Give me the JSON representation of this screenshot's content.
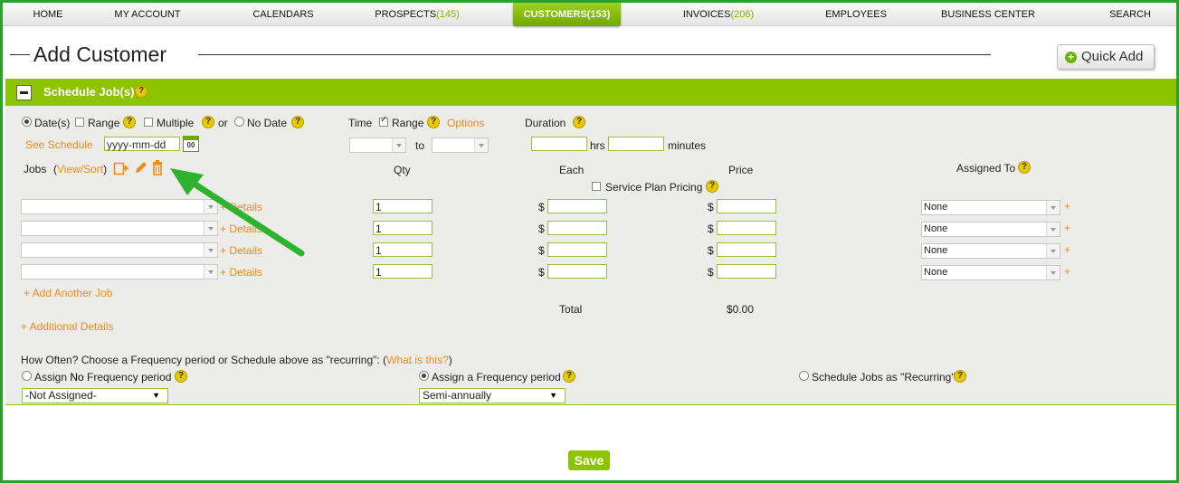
{
  "nav": {
    "items": [
      {
        "label": "HOME",
        "count": ""
      },
      {
        "label": "MY ACCOUNT",
        "count": ""
      },
      {
        "label": "CALENDARS",
        "count": ""
      },
      {
        "label": "PROSPECTS",
        "count": "(145)"
      },
      {
        "label": "INVOICES",
        "count": "(206)"
      },
      {
        "label": "EMPLOYEES",
        "count": ""
      },
      {
        "label": "BUSINESS CENTER",
        "count": ""
      },
      {
        "label": "SEARCH",
        "count": ""
      }
    ],
    "active": {
      "label": "CUSTOMERS",
      "count": "(153)"
    }
  },
  "header": {
    "title": "Add Customer",
    "quick_add": "Quick Add"
  },
  "section": {
    "title": "Schedule Job(s)"
  },
  "date": {
    "dates_label": "Date(s)",
    "range_label": "Range",
    "multiple_label": "Multiple",
    "or_label": "or",
    "no_date_label": "No Date",
    "see_schedule": "See Schedule",
    "date_placeholder": "yyyy-mm-dd",
    "cal_day": "00"
  },
  "time": {
    "label": "Time",
    "range_label": "Range",
    "options_link": "Options",
    "to_label": "to"
  },
  "duration": {
    "label": "Duration",
    "hrs_label": "hrs",
    "minutes_label": "minutes"
  },
  "jobs": {
    "label": "Jobs",
    "view_sort": "View/Sort",
    "open_paren": "(",
    "close_paren": ")",
    "cols": {
      "qty": "Qty",
      "each": "Each",
      "price": "Price",
      "assigned": "Assigned To"
    },
    "service_plan": "Service Plan Pricing",
    "currency": "$",
    "details_label": "+ Details",
    "add_plus": "+",
    "rows": [
      {
        "qty": "1",
        "each": "",
        "price": "",
        "assigned": "None"
      },
      {
        "qty": "1",
        "each": "",
        "price": "",
        "assigned": "None"
      },
      {
        "qty": "1",
        "each": "",
        "price": "",
        "assigned": "None"
      },
      {
        "qty": "1",
        "each": "",
        "price": "",
        "assigned": "None"
      }
    ],
    "add_another": "+ Add Another Job",
    "total_label": "Total",
    "total_value": "$0.00",
    "additional_details": "+ Additional Details"
  },
  "frequency": {
    "question_prefix": "How Often? Choose a Frequency period or Schedule above as \"recurring\": (",
    "what_link": "What is this?",
    "question_suffix": ")",
    "assign_no_1": "Assign ",
    "assign_no_bold": "No",
    "assign_no_2": " Frequency period",
    "assign_a": "Assign a Frequency period",
    "recurring": "Schedule Jobs as \"Recurring\"",
    "select1": "-Not Assigned-",
    "select2": "Semi-annually"
  },
  "help_glyph": "?",
  "select_triangle": "▼",
  "save_label": "Save",
  "colors": {
    "accent": "#8cc400",
    "link": "#f08c12",
    "border": "#2ca02c"
  }
}
